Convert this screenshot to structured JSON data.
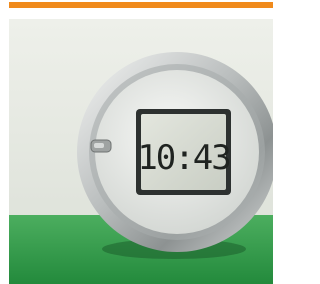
{
  "header": {
    "accent_color": "#f08a1c"
  },
  "photo": {
    "subject_icon": "digital-clock",
    "clock_display": "10:43",
    "colors": {
      "wall": "#e9ece6",
      "table": "#2f9a4a",
      "lcd": "#d9ddd2",
      "digits": "#1f2320",
      "bezel": "#c3c7c6"
    }
  }
}
